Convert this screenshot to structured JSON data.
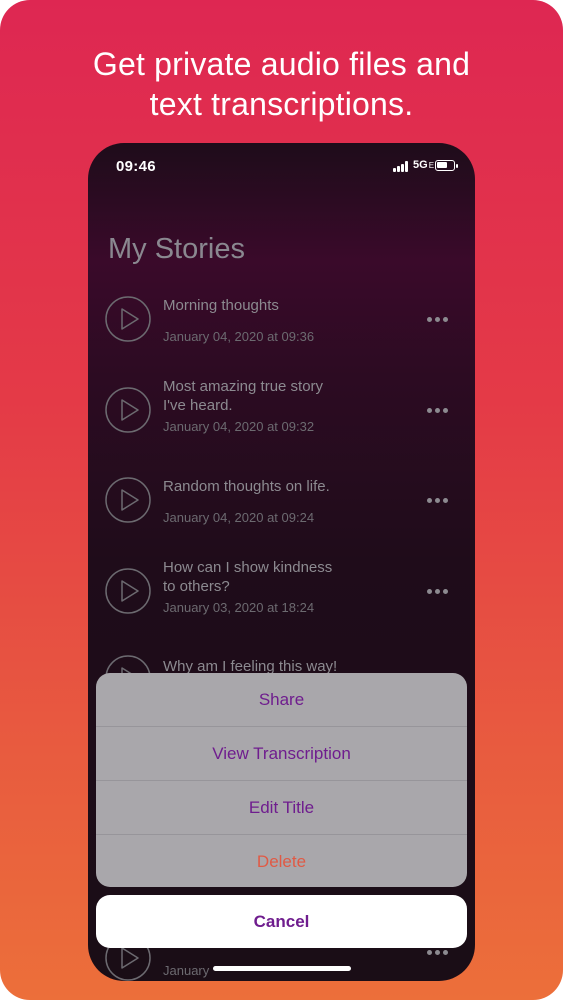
{
  "headline": {
    "line1": "Get private audio files and",
    "line2": "text transcriptions."
  },
  "status_bar": {
    "time": "09:46",
    "network": "5G",
    "network_suffix": "E"
  },
  "screen": {
    "title": "My Stories"
  },
  "stories": [
    {
      "line1": "Morning thoughts",
      "line2": "",
      "date": "January 04, 2020 at 09:36"
    },
    {
      "line1": "Most amazing true story",
      "line2": "I've heard.",
      "date": "January 04, 2020 at 09:32"
    },
    {
      "line1": "Random thoughts on life.",
      "line2": "",
      "date": "January 04, 2020 at 09:24"
    },
    {
      "line1": "How can I show kindness",
      "line2": "to others?",
      "date": "January 03, 2020 at 18:24"
    },
    {
      "line1": "Why am I feeling this way!",
      "line2": "",
      "date": ""
    }
  ],
  "partial_row": {
    "date": "January"
  },
  "action_sheet": {
    "share": "Share",
    "view_transcription": "View Transcription",
    "edit_title": "Edit Title",
    "delete": "Delete",
    "cancel": "Cancel"
  },
  "colors": {
    "accent": "#6f1d8e",
    "destructive": "#e05a45",
    "poster_top": "#de2752",
    "poster_bottom": "#ec6f3a"
  }
}
